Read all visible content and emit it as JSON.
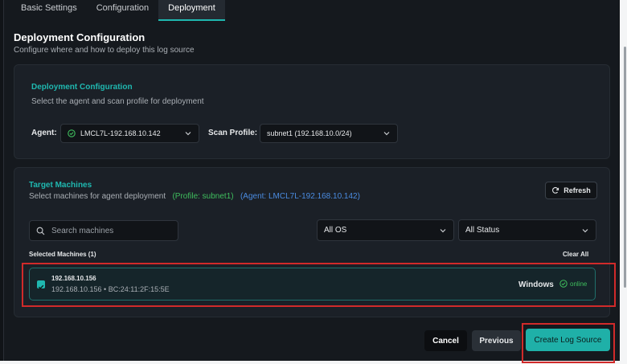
{
  "tabs": [
    {
      "label": "Basic Settings"
    },
    {
      "label": "Configuration"
    },
    {
      "label": "Deployment"
    }
  ],
  "header": {
    "title": "Deployment Configuration",
    "subtitle": "Configure where and how to deploy this log source"
  },
  "deployment": {
    "title": "Deployment Configuration",
    "subtitle": "Select the agent and scan profile for deployment",
    "agent_label": "Agent:",
    "agent_value": "LMCL7L-192.168.10.142",
    "scan_profile_label": "Scan Profile:",
    "scan_profile_value": "subnet1 (192.168.10.0/24)"
  },
  "targets": {
    "title": "Target Machines",
    "subtitle": "Select machines for agent deployment",
    "profile_tag": "(Profile: subnet1)",
    "agent_tag": "(Agent: LMCL7L-192.168.10.142)",
    "refresh_label": "Refresh",
    "search_placeholder": "Search machines",
    "os_filter": "All OS",
    "status_filter": "All Status",
    "selected_label": "Selected Machines (1)",
    "clear_all_label": "Clear All",
    "machines": [
      {
        "ip": "192.168.10.156",
        "detail": "192.168.10.156 • BC:24:11:2F:15:5E",
        "os": "Windows",
        "status": "online",
        "selected": true
      }
    ]
  },
  "footer": {
    "cancel_label": "Cancel",
    "previous_label": "Previous",
    "create_label": "Create Log Source"
  },
  "colors": {
    "accent": "#1fb8b0",
    "success": "#3fbf5e",
    "info": "#4a8be0",
    "highlight": "#d12a2a"
  }
}
